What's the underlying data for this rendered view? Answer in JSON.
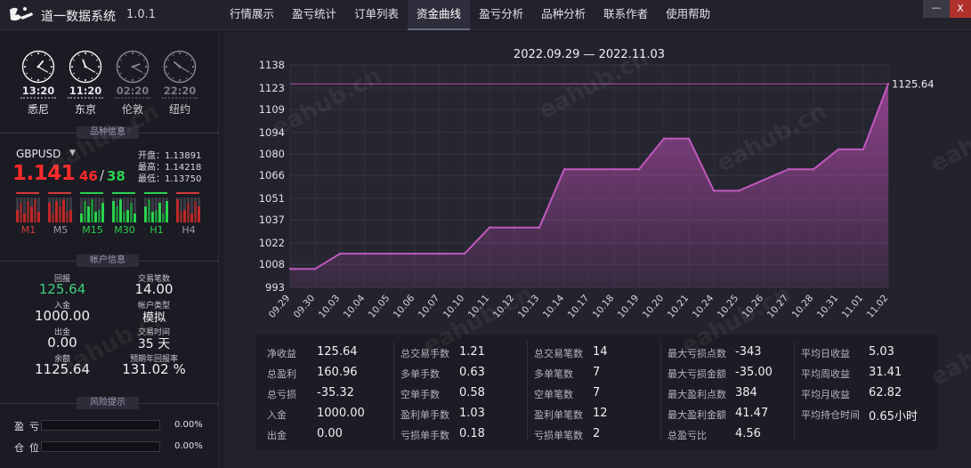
{
  "app": {
    "title": "道一数据系统",
    "version": "1.0.1"
  },
  "nav": {
    "tabs": [
      "行情展示",
      "盈亏统计",
      "订单列表",
      "资金曲线",
      "盈亏分析",
      "品种分析",
      "联系作者",
      "使用帮助"
    ],
    "active_index": 3
  },
  "window": {
    "minimize": "—",
    "close": "X"
  },
  "clocks": [
    {
      "time": "13:20",
      "city": "悉尼",
      "hour": 13,
      "minute": 20,
      "active": true
    },
    {
      "time": "11:20",
      "city": "东京",
      "hour": 11,
      "minute": 20,
      "active": true
    },
    {
      "time": "02:20",
      "city": "伦敦",
      "hour": 2,
      "minute": 20,
      "active": false
    },
    {
      "time": "22:20",
      "city": "纽约",
      "hour": 22,
      "minute": 20,
      "active": false
    }
  ],
  "sections": {
    "symbol": "品种信息",
    "account": "帐户信息",
    "risk": "风险提示"
  },
  "symbol": {
    "name": "GBPUSD",
    "price_main": "1.141",
    "price_pip": "46",
    "price_pip2": "38",
    "open": "开盘：1.13891",
    "high": "最高：1.14218",
    "low": "最低：1.13750"
  },
  "timeframes": [
    {
      "label": "M1",
      "color": "#d23a3a"
    },
    {
      "label": "M5",
      "color": "#9a9aa4"
    },
    {
      "label": "M15",
      "color": "#2bd14f"
    },
    {
      "label": "M30",
      "color": "#2bd14f"
    },
    {
      "label": "H1",
      "color": "#2bd14f"
    },
    {
      "label": "H4",
      "color": "#9a9aa4"
    }
  ],
  "account": {
    "profit_label": "回报",
    "profit": "125.64",
    "trades_label": "交易笔数",
    "trades": "14.00",
    "deposit_label": "入金",
    "deposit": "1000.00",
    "type_label": "帐户类型",
    "type": "模拟",
    "withdraw_label": "出金",
    "withdraw": "0.00",
    "days_label": "交易时间",
    "days": "35 天",
    "balance_label": "余额",
    "balance": "1125.64",
    "annual_label": "预期年回报率",
    "annual": "131.02 %"
  },
  "risk": [
    {
      "label": "盈亏",
      "value": "0.00%",
      "fill": 0
    },
    {
      "label": "仓位",
      "value": "0.00%",
      "fill": 0
    }
  ],
  "chart_data": {
    "type": "area",
    "title": "2022.09.29 — 2022.11.03",
    "x": [
      "09.29",
      "09.30",
      "10.03",
      "10.04",
      "10.05",
      "10.06",
      "10.07",
      "10.10",
      "10.11",
      "10.12",
      "10.13",
      "10.14",
      "10.17",
      "10.18",
      "10.19",
      "10.20",
      "10.21",
      "10.24",
      "10.25",
      "10.26",
      "10.27",
      "10.28",
      "10.31",
      "11.01",
      "11.02"
    ],
    "values": [
      1005,
      1005,
      1015,
      1015,
      1015,
      1015,
      1015,
      1015,
      1032,
      1032,
      1032,
      1070,
      1070,
      1070,
      1070,
      1090,
      1090,
      1056,
      1056,
      1063,
      1070,
      1070,
      1083,
      1083,
      1125.64
    ],
    "yticks": [
      993,
      1008,
      1022,
      1037,
      1051,
      1066,
      1080,
      1094,
      1109,
      1123,
      1138
    ],
    "ylim": [
      993,
      1138
    ],
    "last_label": "1125.64",
    "color": "#b04aa8"
  },
  "stats": [
    [
      {
        "label": "净收益",
        "value": "125.64"
      },
      {
        "label": "总盈利",
        "value": "160.96"
      },
      {
        "label": "总亏损",
        "value": "-35.32"
      },
      {
        "label": "入金",
        "value": "1000.00"
      },
      {
        "label": "出金",
        "value": "0.00"
      }
    ],
    [
      {
        "label": "总交易手数",
        "value": "1.21"
      },
      {
        "label": "多单手数",
        "value": "0.63"
      },
      {
        "label": "空单手数",
        "value": "0.58"
      },
      {
        "label": "盈利单手数",
        "value": "1.03"
      },
      {
        "label": "亏损单手数",
        "value": "0.18"
      }
    ],
    [
      {
        "label": "总交易笔数",
        "value": "14"
      },
      {
        "label": "多单笔数",
        "value": "7"
      },
      {
        "label": "空单笔数",
        "value": "7"
      },
      {
        "label": "盈利单笔数",
        "value": "12"
      },
      {
        "label": "亏损单笔数",
        "value": "2"
      }
    ],
    [
      {
        "label": "最大亏损点数",
        "value": "-343"
      },
      {
        "label": "最大亏损金额",
        "value": "-35.00"
      },
      {
        "label": "最大盈利点数",
        "value": "384"
      },
      {
        "label": "最大盈利金额",
        "value": "41.47"
      },
      {
        "label": "总盈亏比",
        "value": "4.56"
      }
    ],
    [
      {
        "label": "平均日收益",
        "value": "5.03"
      },
      {
        "label": "平均周收益",
        "value": "31.41"
      },
      {
        "label": "平均月收益",
        "value": "62.82"
      },
      {
        "label": "平均持仓时间",
        "value": "0.65小时"
      }
    ]
  ],
  "watermark": "eahub.cn"
}
